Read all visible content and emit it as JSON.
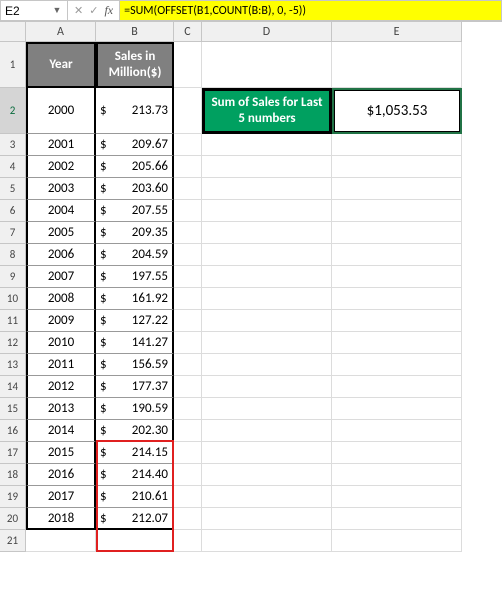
{
  "name_box": {
    "value": "E2"
  },
  "formula_bar": {
    "value": "=SUM(OFFSET(B1,COUNT(B:B), 0, -5))"
  },
  "icons": {
    "dropdown": "▼",
    "cancel": "✕",
    "enter": "✓",
    "fx": "fx"
  },
  "columns": [
    "A",
    "B",
    "C",
    "D",
    "E"
  ],
  "row_numbers": [
    "1",
    "2",
    "3",
    "4",
    "5",
    "6",
    "7",
    "8",
    "9",
    "10",
    "11",
    "12",
    "13",
    "14",
    "15",
    "16",
    "17",
    "18",
    "19",
    "20",
    "21"
  ],
  "headers": {
    "A": "Year",
    "B": "Sales in Million($)"
  },
  "summary": {
    "label": "Sum of Sales for Last 5 numbers",
    "value": "$1,053.53"
  },
  "data": [
    {
      "year": "2000",
      "sales": "213.73"
    },
    {
      "year": "2001",
      "sales": "209.67"
    },
    {
      "year": "2002",
      "sales": "205.66"
    },
    {
      "year": "2003",
      "sales": "203.60"
    },
    {
      "year": "2004",
      "sales": "207.55"
    },
    {
      "year": "2005",
      "sales": "209.35"
    },
    {
      "year": "2006",
      "sales": "204.59"
    },
    {
      "year": "2007",
      "sales": "197.55"
    },
    {
      "year": "2008",
      "sales": "161.92"
    },
    {
      "year": "2009",
      "sales": "127.22"
    },
    {
      "year": "2010",
      "sales": "141.27"
    },
    {
      "year": "2011",
      "sales": "156.59"
    },
    {
      "year": "2012",
      "sales": "177.37"
    },
    {
      "year": "2013",
      "sales": "190.59"
    },
    {
      "year": "2014",
      "sales": "202.30"
    },
    {
      "year": "2015",
      "sales": "214.15"
    },
    {
      "year": "2016",
      "sales": "214.40"
    },
    {
      "year": "2017",
      "sales": "210.61"
    },
    {
      "year": "2018",
      "sales": "212.07"
    }
  ],
  "chart_data": {
    "type": "table",
    "title": "Sales in Million($) by Year",
    "columns": [
      "Year",
      "Sales in Million($)"
    ],
    "rows": [
      [
        "2000",
        213.73
      ],
      [
        "2001",
        209.67
      ],
      [
        "2002",
        205.66
      ],
      [
        "2003",
        203.6
      ],
      [
        "2004",
        207.55
      ],
      [
        "2005",
        209.35
      ],
      [
        "2006",
        204.59
      ],
      [
        "2007",
        197.55
      ],
      [
        "2008",
        161.92
      ],
      [
        "2009",
        127.22
      ],
      [
        "2010",
        141.27
      ],
      [
        "2011",
        156.59
      ],
      [
        "2012",
        177.37
      ],
      [
        "2013",
        190.59
      ],
      [
        "2014",
        202.3
      ],
      [
        "2015",
        214.15
      ],
      [
        "2016",
        214.4
      ],
      [
        "2017",
        210.61
      ],
      [
        "2018",
        212.07
      ]
    ],
    "summary": {
      "label": "Sum of Sales for Last 5 numbers",
      "value": 1053.53
    }
  }
}
